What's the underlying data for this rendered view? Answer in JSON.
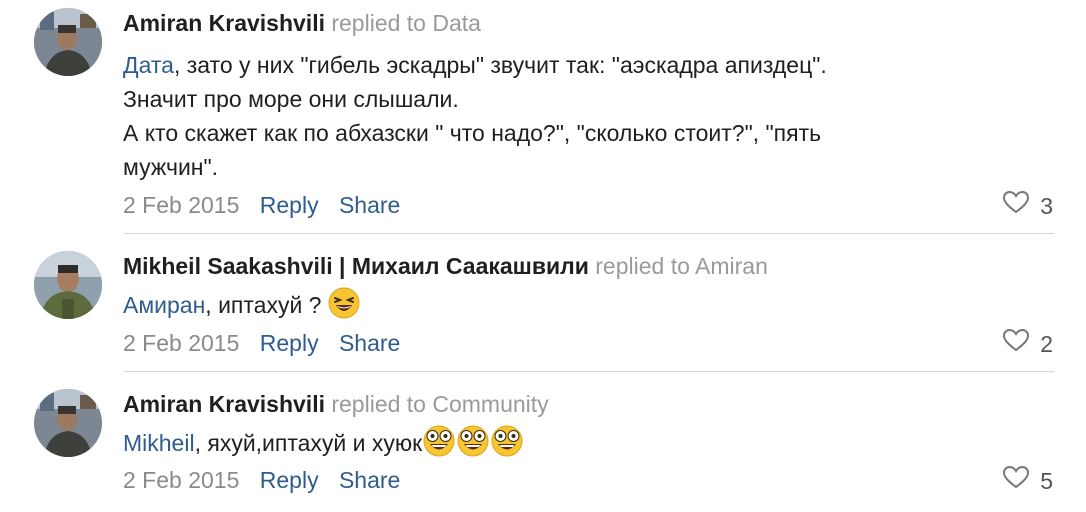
{
  "comments": [
    {
      "author": "Amiran Kravishvili",
      "replied_to": "replied to Data",
      "lines": [
        {
          "mention": "Дата",
          "text": ", зато у них \"гибель эскадры\" звучит так: \"аэскадра апиздец\"."
        },
        {
          "mention": "",
          "text": "Значит про море они слышали."
        },
        {
          "mention": "",
          "text": "А кто скажет как по абхазски \" что надо?\", \"сколько стоит?\", \"пять"
        },
        {
          "mention": "",
          "text": "мужчин\"."
        }
      ],
      "date": "2 Feb 2015",
      "reply": "Reply",
      "share": "Share",
      "likes": "3"
    },
    {
      "author": "Mikheil Saakashvili | Михаил Саакашвили",
      "replied_to": "replied to Amiran",
      "mention": "Амиран",
      "text": ", иптахуй ? ",
      "emoji": "laughing-emoji",
      "date": "2 Feb 2015",
      "reply": "Reply",
      "share": "Share",
      "likes": "2"
    },
    {
      "author": "Amiran Kravishvili",
      "replied_to": "replied to Community",
      "mention": "Mikheil",
      "text": ", яхуй,иптахуй и хуюк",
      "emoji": "crazy-face-emoji",
      "date": "2 Feb 2015",
      "reply": "Reply",
      "share": "Share",
      "likes": "5"
    }
  ],
  "colors": {
    "link": "#2f5c8f",
    "muted": "#9a9a9a",
    "divider": "#d7d7d7",
    "emoji_yellow": "#f7c531"
  }
}
